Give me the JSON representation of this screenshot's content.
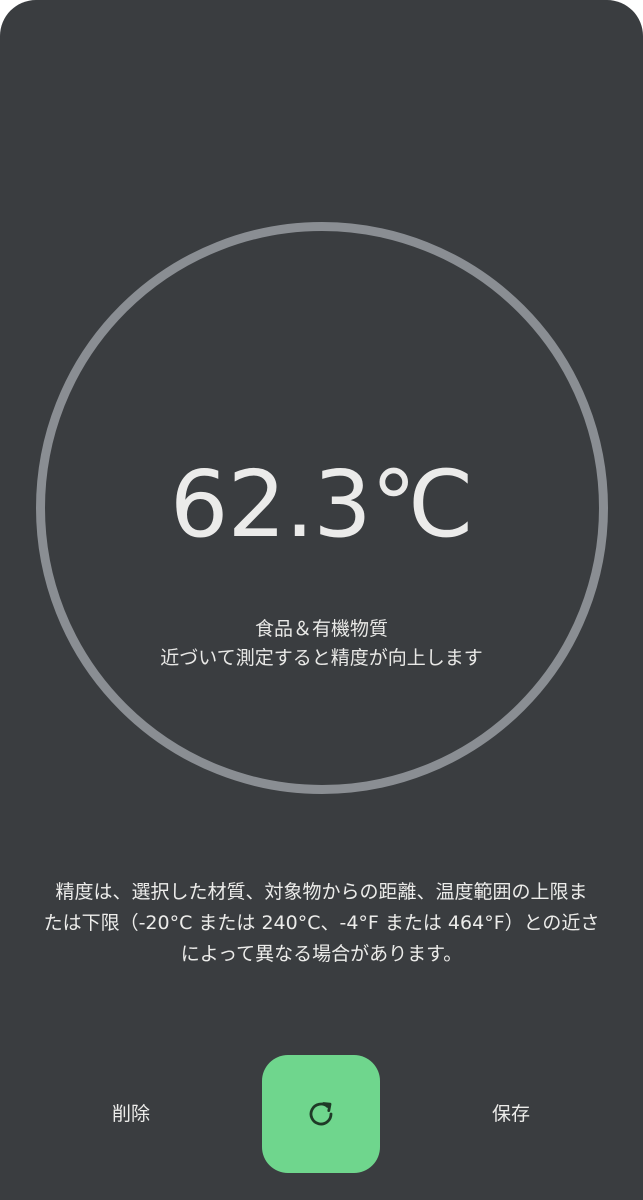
{
  "measurement": {
    "temperature": "62.3℃",
    "material": "食品＆有機物質",
    "hint": "近づいて測定すると精度が向上します"
  },
  "disclaimer": {
    "lines": [
      "精度は、選択した材質、対象物からの距離、温度範囲の上限ま",
      "たは下限（-20°C または 240°C、-4°F または 464°F）との近さ",
      "によって異なる場合があります。"
    ]
  },
  "actions": {
    "delete_label": "削除",
    "refresh_icon": "refresh-icon",
    "save_label": "保存"
  },
  "colors": {
    "background": "#3a3d40",
    "ring": "#8a8e93",
    "accent": "#6fd68d",
    "text": "#ececea"
  }
}
